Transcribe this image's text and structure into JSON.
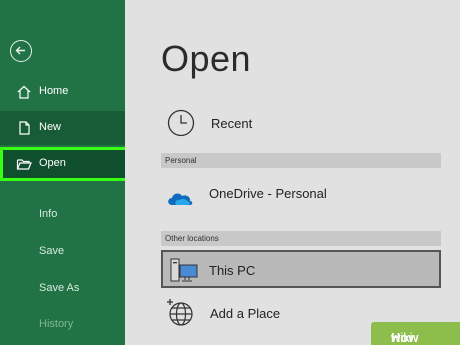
{
  "sidebar": {
    "home_label": "Home",
    "new_label": "New",
    "open_label": "Open",
    "info_label": "Info",
    "save_label": "Save",
    "saveas_label": "Save As",
    "history_label": "History"
  },
  "main": {
    "title": "Open",
    "recent_label": "Recent",
    "section_personal": "Personal",
    "onedrive_label": "OneDrive - Personal",
    "section_other": "Other locations",
    "thispc_label": "This PC",
    "addplace_label": "Add a Place"
  },
  "watermark": {
    "wiki": "wiki",
    "how": "How"
  },
  "colors": {
    "sidebar": "#217346",
    "highlight": "#39ff14",
    "onedrive": "#0f6cbd"
  },
  "icons": [
    "back-arrow-icon",
    "home-icon",
    "new-document-icon",
    "folder-open-icon",
    "clock-icon",
    "onedrive-cloud-icon",
    "computer-icon",
    "globe-add-icon"
  ]
}
